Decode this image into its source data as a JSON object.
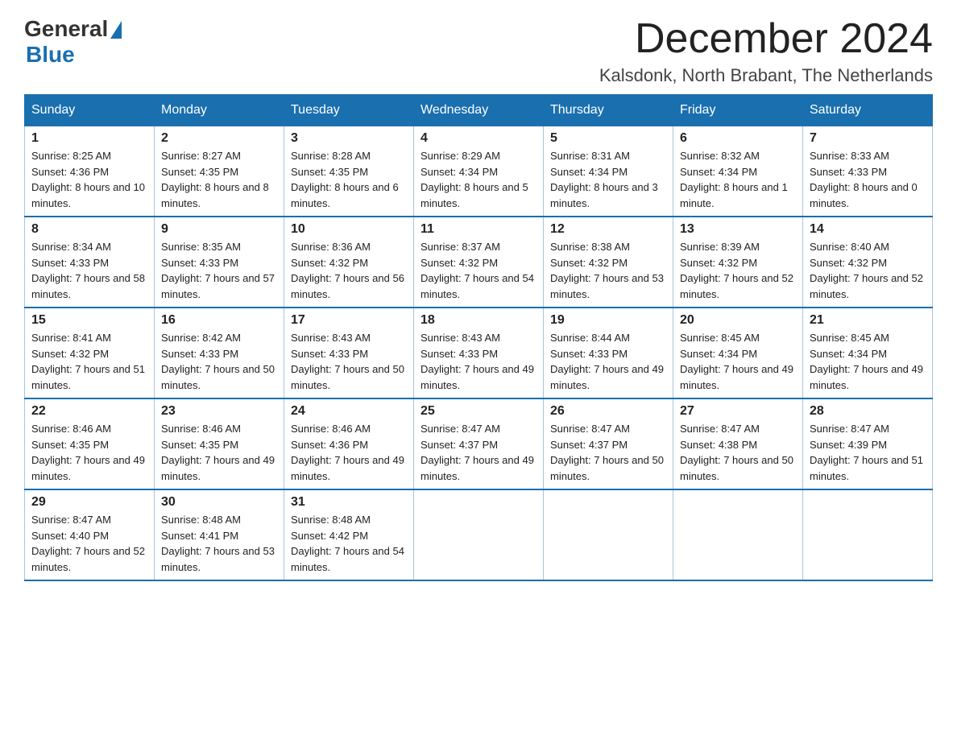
{
  "logo": {
    "general": "General",
    "blue": "Blue"
  },
  "title": "December 2024",
  "location": "Kalsdonk, North Brabant, The Netherlands",
  "weekdays": [
    "Sunday",
    "Monday",
    "Tuesday",
    "Wednesday",
    "Thursday",
    "Friday",
    "Saturday"
  ],
  "weeks": [
    [
      {
        "day": "1",
        "sunrise": "8:25 AM",
        "sunset": "4:36 PM",
        "daylight": "8 hours and 10 minutes."
      },
      {
        "day": "2",
        "sunrise": "8:27 AM",
        "sunset": "4:35 PM",
        "daylight": "8 hours and 8 minutes."
      },
      {
        "day": "3",
        "sunrise": "8:28 AM",
        "sunset": "4:35 PM",
        "daylight": "8 hours and 6 minutes."
      },
      {
        "day": "4",
        "sunrise": "8:29 AM",
        "sunset": "4:34 PM",
        "daylight": "8 hours and 5 minutes."
      },
      {
        "day": "5",
        "sunrise": "8:31 AM",
        "sunset": "4:34 PM",
        "daylight": "8 hours and 3 minutes."
      },
      {
        "day": "6",
        "sunrise": "8:32 AM",
        "sunset": "4:34 PM",
        "daylight": "8 hours and 1 minute."
      },
      {
        "day": "7",
        "sunrise": "8:33 AM",
        "sunset": "4:33 PM",
        "daylight": "8 hours and 0 minutes."
      }
    ],
    [
      {
        "day": "8",
        "sunrise": "8:34 AM",
        "sunset": "4:33 PM",
        "daylight": "7 hours and 58 minutes."
      },
      {
        "day": "9",
        "sunrise": "8:35 AM",
        "sunset": "4:33 PM",
        "daylight": "7 hours and 57 minutes."
      },
      {
        "day": "10",
        "sunrise": "8:36 AM",
        "sunset": "4:32 PM",
        "daylight": "7 hours and 56 minutes."
      },
      {
        "day": "11",
        "sunrise": "8:37 AM",
        "sunset": "4:32 PM",
        "daylight": "7 hours and 54 minutes."
      },
      {
        "day": "12",
        "sunrise": "8:38 AM",
        "sunset": "4:32 PM",
        "daylight": "7 hours and 53 minutes."
      },
      {
        "day": "13",
        "sunrise": "8:39 AM",
        "sunset": "4:32 PM",
        "daylight": "7 hours and 52 minutes."
      },
      {
        "day": "14",
        "sunrise": "8:40 AM",
        "sunset": "4:32 PM",
        "daylight": "7 hours and 52 minutes."
      }
    ],
    [
      {
        "day": "15",
        "sunrise": "8:41 AM",
        "sunset": "4:32 PM",
        "daylight": "7 hours and 51 minutes."
      },
      {
        "day": "16",
        "sunrise": "8:42 AM",
        "sunset": "4:33 PM",
        "daylight": "7 hours and 50 minutes."
      },
      {
        "day": "17",
        "sunrise": "8:43 AM",
        "sunset": "4:33 PM",
        "daylight": "7 hours and 50 minutes."
      },
      {
        "day": "18",
        "sunrise": "8:43 AM",
        "sunset": "4:33 PM",
        "daylight": "7 hours and 49 minutes."
      },
      {
        "day": "19",
        "sunrise": "8:44 AM",
        "sunset": "4:33 PM",
        "daylight": "7 hours and 49 minutes."
      },
      {
        "day": "20",
        "sunrise": "8:45 AM",
        "sunset": "4:34 PM",
        "daylight": "7 hours and 49 minutes."
      },
      {
        "day": "21",
        "sunrise": "8:45 AM",
        "sunset": "4:34 PM",
        "daylight": "7 hours and 49 minutes."
      }
    ],
    [
      {
        "day": "22",
        "sunrise": "8:46 AM",
        "sunset": "4:35 PM",
        "daylight": "7 hours and 49 minutes."
      },
      {
        "day": "23",
        "sunrise": "8:46 AM",
        "sunset": "4:35 PM",
        "daylight": "7 hours and 49 minutes."
      },
      {
        "day": "24",
        "sunrise": "8:46 AM",
        "sunset": "4:36 PM",
        "daylight": "7 hours and 49 minutes."
      },
      {
        "day": "25",
        "sunrise": "8:47 AM",
        "sunset": "4:37 PM",
        "daylight": "7 hours and 49 minutes."
      },
      {
        "day": "26",
        "sunrise": "8:47 AM",
        "sunset": "4:37 PM",
        "daylight": "7 hours and 50 minutes."
      },
      {
        "day": "27",
        "sunrise": "8:47 AM",
        "sunset": "4:38 PM",
        "daylight": "7 hours and 50 minutes."
      },
      {
        "day": "28",
        "sunrise": "8:47 AM",
        "sunset": "4:39 PM",
        "daylight": "7 hours and 51 minutes."
      }
    ],
    [
      {
        "day": "29",
        "sunrise": "8:47 AM",
        "sunset": "4:40 PM",
        "daylight": "7 hours and 52 minutes."
      },
      {
        "day": "30",
        "sunrise": "8:48 AM",
        "sunset": "4:41 PM",
        "daylight": "7 hours and 53 minutes."
      },
      {
        "day": "31",
        "sunrise": "8:48 AM",
        "sunset": "4:42 PM",
        "daylight": "7 hours and 54 minutes."
      },
      null,
      null,
      null,
      null
    ]
  ]
}
